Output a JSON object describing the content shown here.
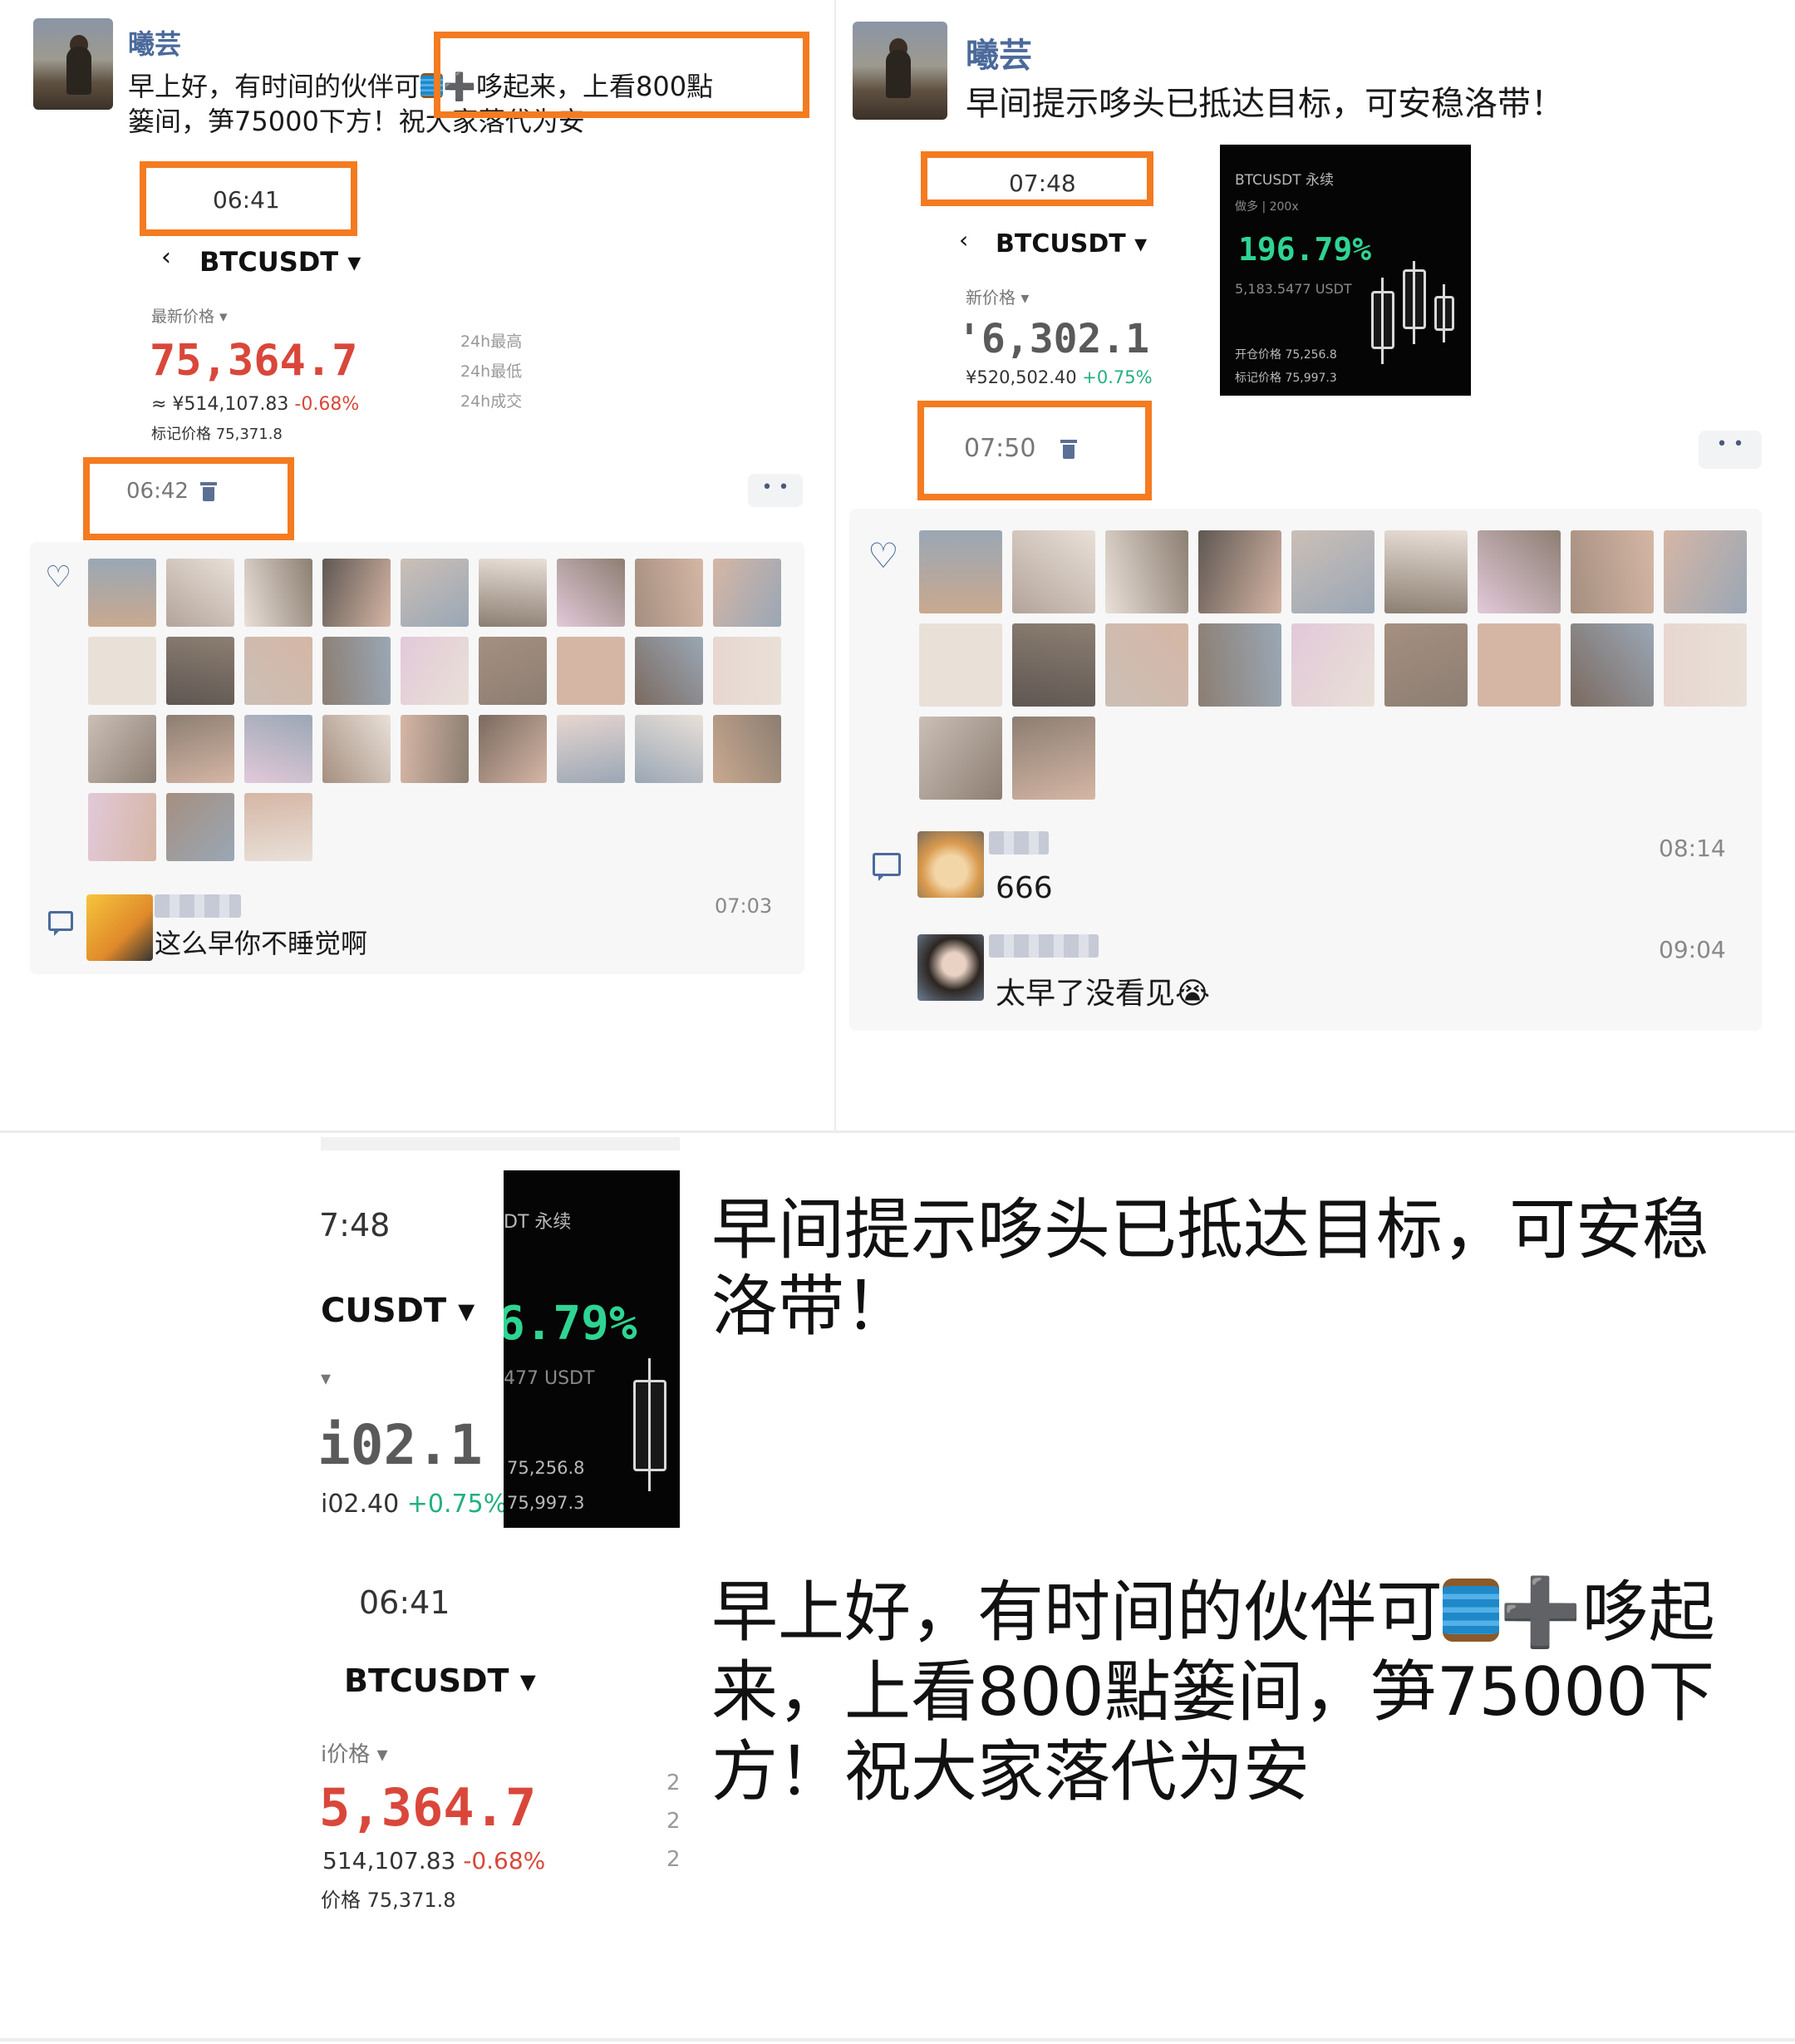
{
  "post1": {
    "author": "曦芸",
    "text_line1": "早上好，有时间的伙伴可",
    "text_hl": "➕哆起来，上看800點",
    "text_line2": "篓间，笋75000下方！祝大家落代为安",
    "screenshot": {
      "time": "06:41",
      "symbol": "BTCUSDT",
      "latest_label": "最新价格",
      "price": "75,364.7",
      "cny": "≈ ¥514,107.83",
      "change": "-0.68%",
      "mark_label": "标记价格 75,371.8",
      "side_high": "24h最高",
      "side_low": "24h最低",
      "side_vol": "24h成交"
    },
    "post_time": "06:42",
    "comment": {
      "text": "这么早你不睡觉啊",
      "time": "07:03"
    }
  },
  "post2": {
    "author": "曦芸",
    "text": "早间提示哆头已抵达目标，可安稳洛带！",
    "screenshot": {
      "time": "07:48",
      "symbol": "BTCUSDT",
      "latest_label": "新价格",
      "price": "'6,302.1",
      "cny": "¥520,502.40",
      "change": "+0.75%",
      "card_title": "BTCUSDT 永续",
      "card_sub": "做多 | 200x",
      "card_pct": "196.79%",
      "card_usdt": "5,183.5477 USDT",
      "card_open": "开仓价格 75,256.8",
      "card_mark": "标记价格 75,997.3"
    },
    "post_time": "07:50",
    "comments": [
      {
        "text": "666",
        "time": "08:14"
      },
      {
        "text": "太早了没看见😭",
        "time": "09:04"
      }
    ]
  },
  "bottom": {
    "crop1": {
      "time": "7:48",
      "symbol": "CUSDT",
      "price": "i02.1",
      "sub": "i02.40",
      "change": "+0.75%",
      "card_title": "DT 永续",
      "card_pct": "6.79%",
      "card_usdt": "477 USDT",
      "card_open": "75,256.8",
      "card_mark": "75,997.3"
    },
    "crop2": {
      "time": "06:41",
      "symbol": "BTCUSDT",
      "label": "i价格",
      "price": "5,364.7",
      "sub": "514,107.83",
      "change": "-0.68%",
      "mark": "价格 75,371.8",
      "side": [
        "2",
        "2",
        "2"
      ]
    },
    "text1": "早间提示哆头已抵达目标，可安稳洛带！",
    "text2_a": "早上好，有时间的伙伴可",
    "text2_b": "哆起来，上看800點篓间，笋75000下方！祝大家落代为安"
  },
  "colors": {
    "highlight": "#f47b20",
    "link_blue": "#4b6a9b",
    "red": "#d9473b",
    "green": "#22b07d"
  }
}
